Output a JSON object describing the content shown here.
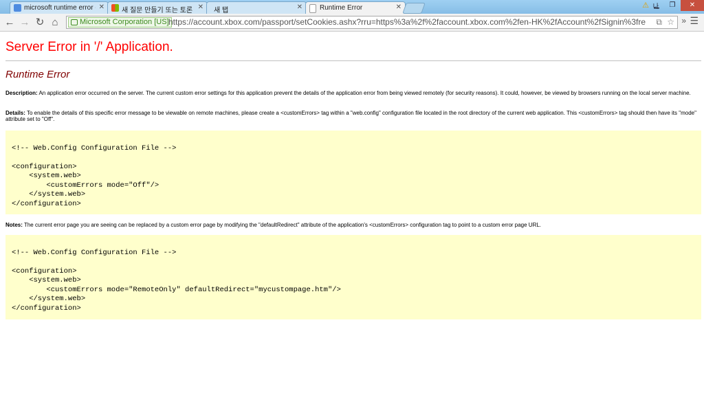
{
  "tabs": [
    {
      "title": "microsoft runtime error -",
      "active": false
    },
    {
      "title": "새 질문 만들기 또는 토론",
      "active": false
    },
    {
      "title": "새 탭",
      "active": false
    },
    {
      "title": "Runtime Error",
      "active": true
    }
  ],
  "window": {
    "user_label": "나"
  },
  "omnibox": {
    "ev_label": "Microsoft Corporation [US]",
    "url": "https://account.xbox.com/passport/setCookies.ashx?rru=https%3a%2f%2faccount.xbox.com%2fen-HK%2fAccount%2fSignin%3fre"
  },
  "page": {
    "title": "Server Error in '/' Application.",
    "subtitle": "Runtime Error",
    "description_label": "Description:",
    "description_text": "An application error occurred on the server. The current custom error settings for this application prevent the details of the application error from being viewed remotely (for security reasons). It could, however, be viewed by browsers running on the local server machine.",
    "details_label": "Details:",
    "details_text": "To enable the details of this specific error message to be viewable on remote machines, please create a <customErrors> tag within a \"web.config\" configuration file located in the root directory of the current web application. This <customErrors> tag should then have its \"mode\" attribute set to \"Off\".",
    "code1": "\n<!-- Web.Config Configuration File -->\n\n<configuration>\n    <system.web>\n        <customErrors mode=\"Off\"/>\n    </system.web>\n</configuration>",
    "notes_label": "Notes:",
    "notes_text": "The current error page you are seeing can be replaced by a custom error page by modifying the \"defaultRedirect\" attribute of the application's <customErrors> configuration tag to point to a custom error page URL.",
    "code2": "\n<!-- Web.Config Configuration File -->\n\n<configuration>\n    <system.web>\n        <customErrors mode=\"RemoteOnly\" defaultRedirect=\"mycustompage.htm\"/>\n    </system.web>\n</configuration>"
  }
}
